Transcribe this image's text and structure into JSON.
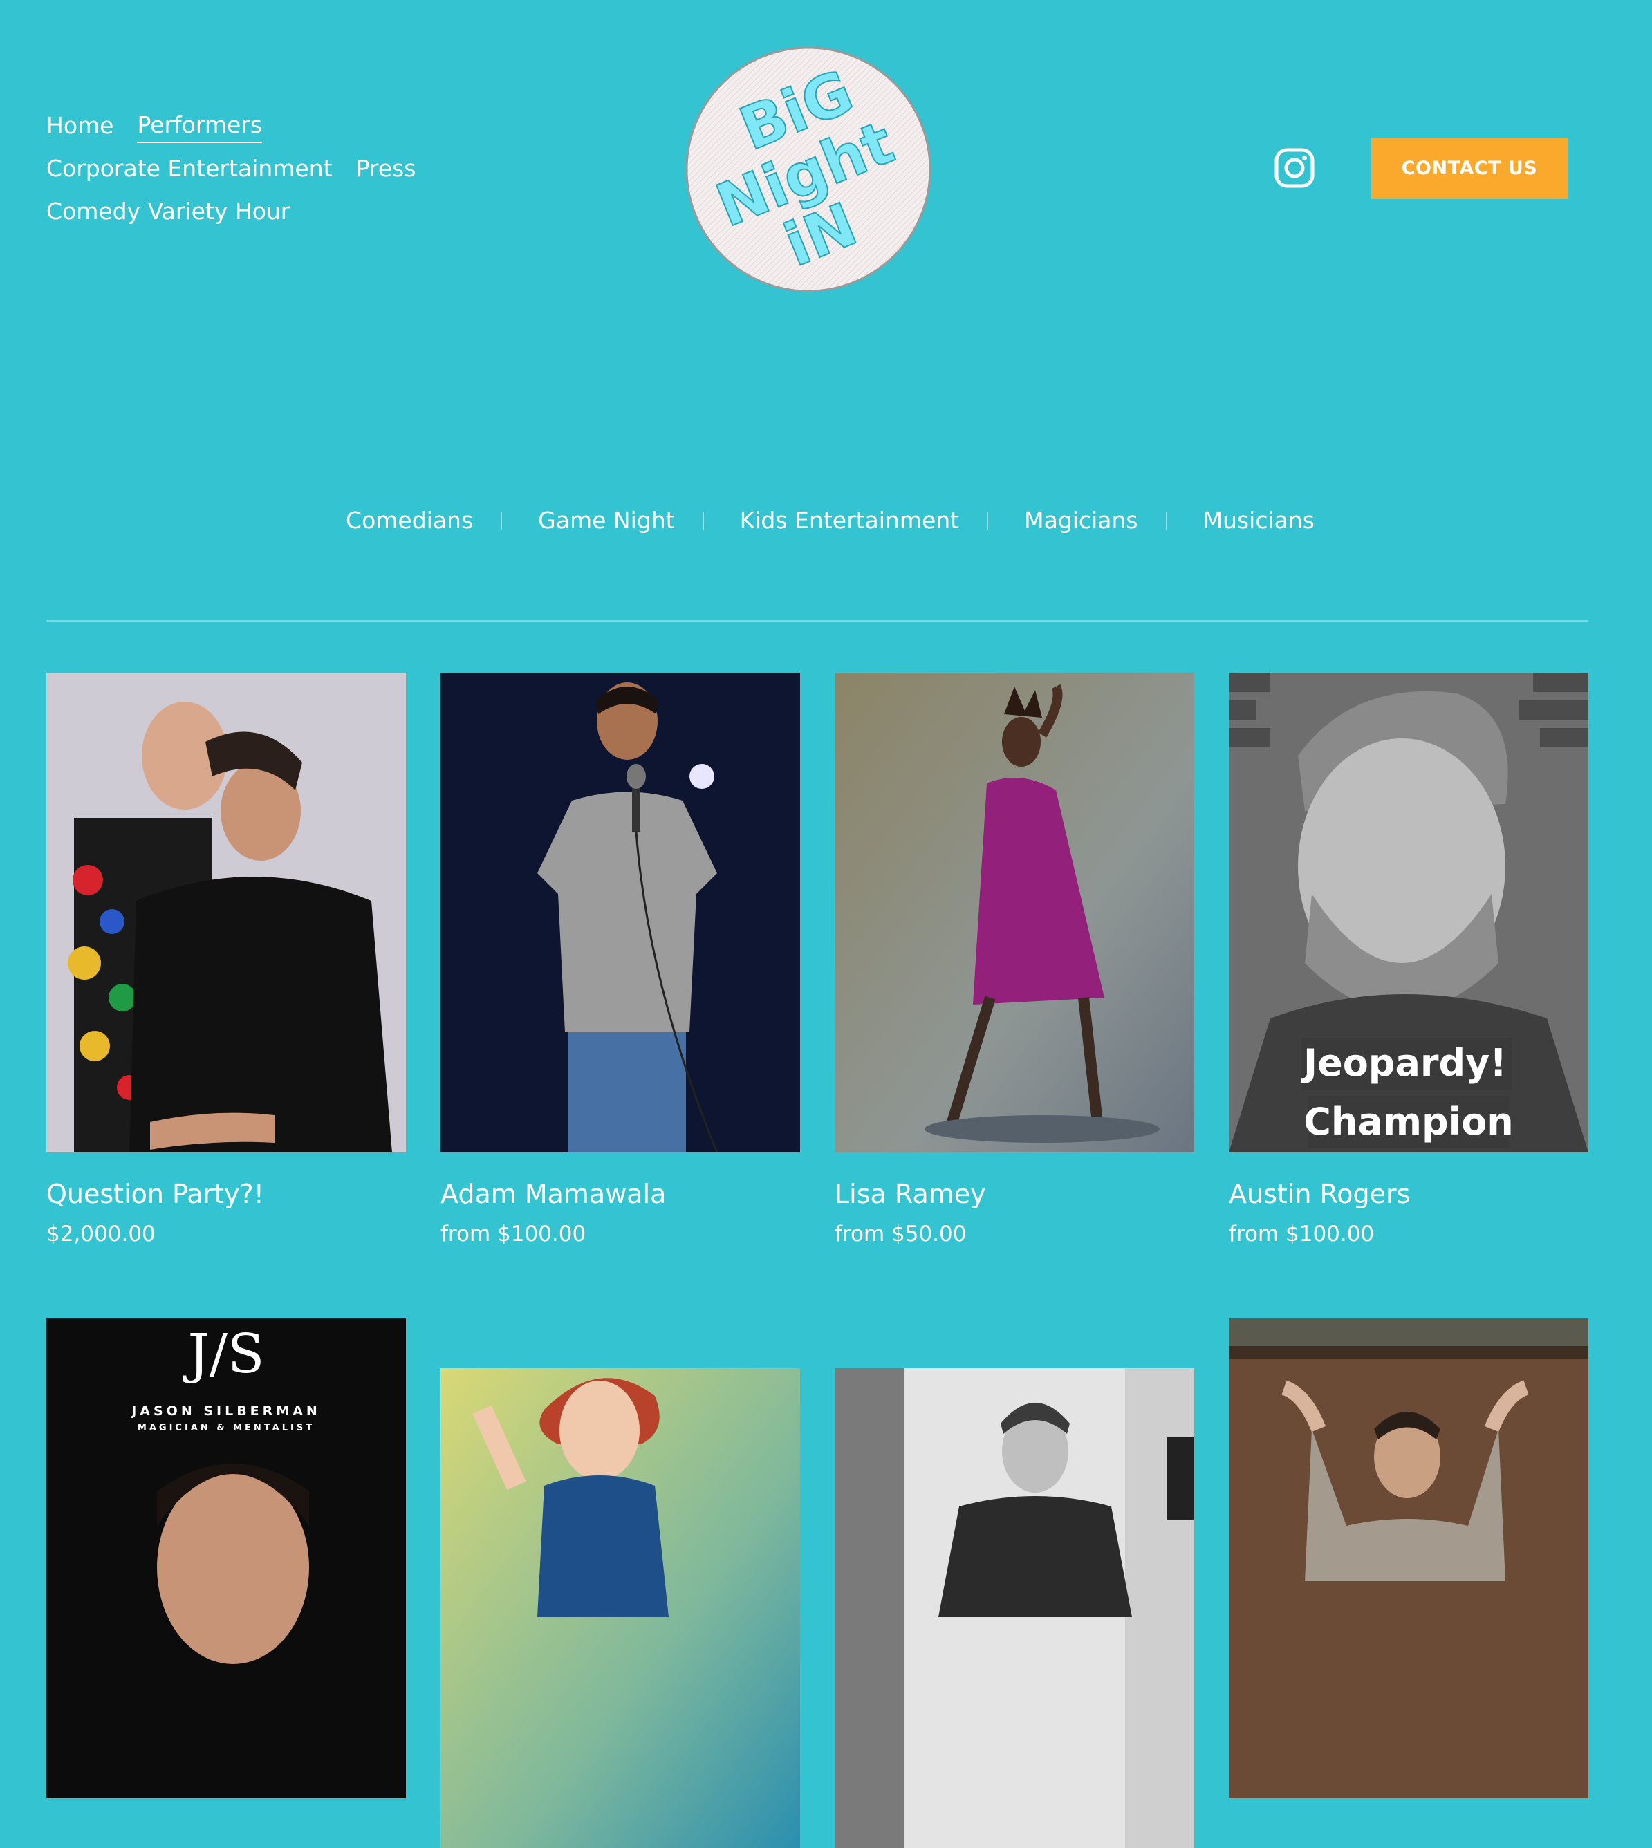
{
  "header": {
    "nav": [
      {
        "label": "Home",
        "active": false
      },
      {
        "label": "Performers",
        "active": true
      },
      {
        "label": "Corporate Entertainment",
        "active": false
      },
      {
        "label": "Press",
        "active": false
      },
      {
        "label": "Comedy Variety Hour",
        "active": false
      }
    ],
    "logo_text": [
      "BiG",
      "Night",
      "iN"
    ],
    "instagram_icon": "instagram-icon",
    "contact_label": "CONTACT US",
    "colors": {
      "background": "#33c3d1",
      "accent": "#fba92d",
      "logo_text": "#7fe7f5"
    }
  },
  "categories": [
    "Comedians",
    "Game Night",
    "Kids Entertainment",
    "Magicians",
    "Musicians"
  ],
  "products": [
    {
      "title": "Question Party?!",
      "price": "$2,000.00"
    },
    {
      "title": "Adam Mamawala",
      "price": "from $100.00"
    },
    {
      "title": "Lisa Ramey",
      "price": "from $50.00"
    },
    {
      "title": "Austin Rogers",
      "price": "from $100.00",
      "overlay": [
        "Jeopardy!",
        "Champion"
      ]
    },
    {
      "title": "",
      "price": "",
      "brand_mark": "J/S",
      "brand_name": "JASON SILBERMAN",
      "brand_sub": "MAGICIAN & MENTALIST"
    },
    {
      "title": "",
      "price": ""
    },
    {
      "title": "",
      "price": ""
    },
    {
      "title": "",
      "price": ""
    }
  ]
}
